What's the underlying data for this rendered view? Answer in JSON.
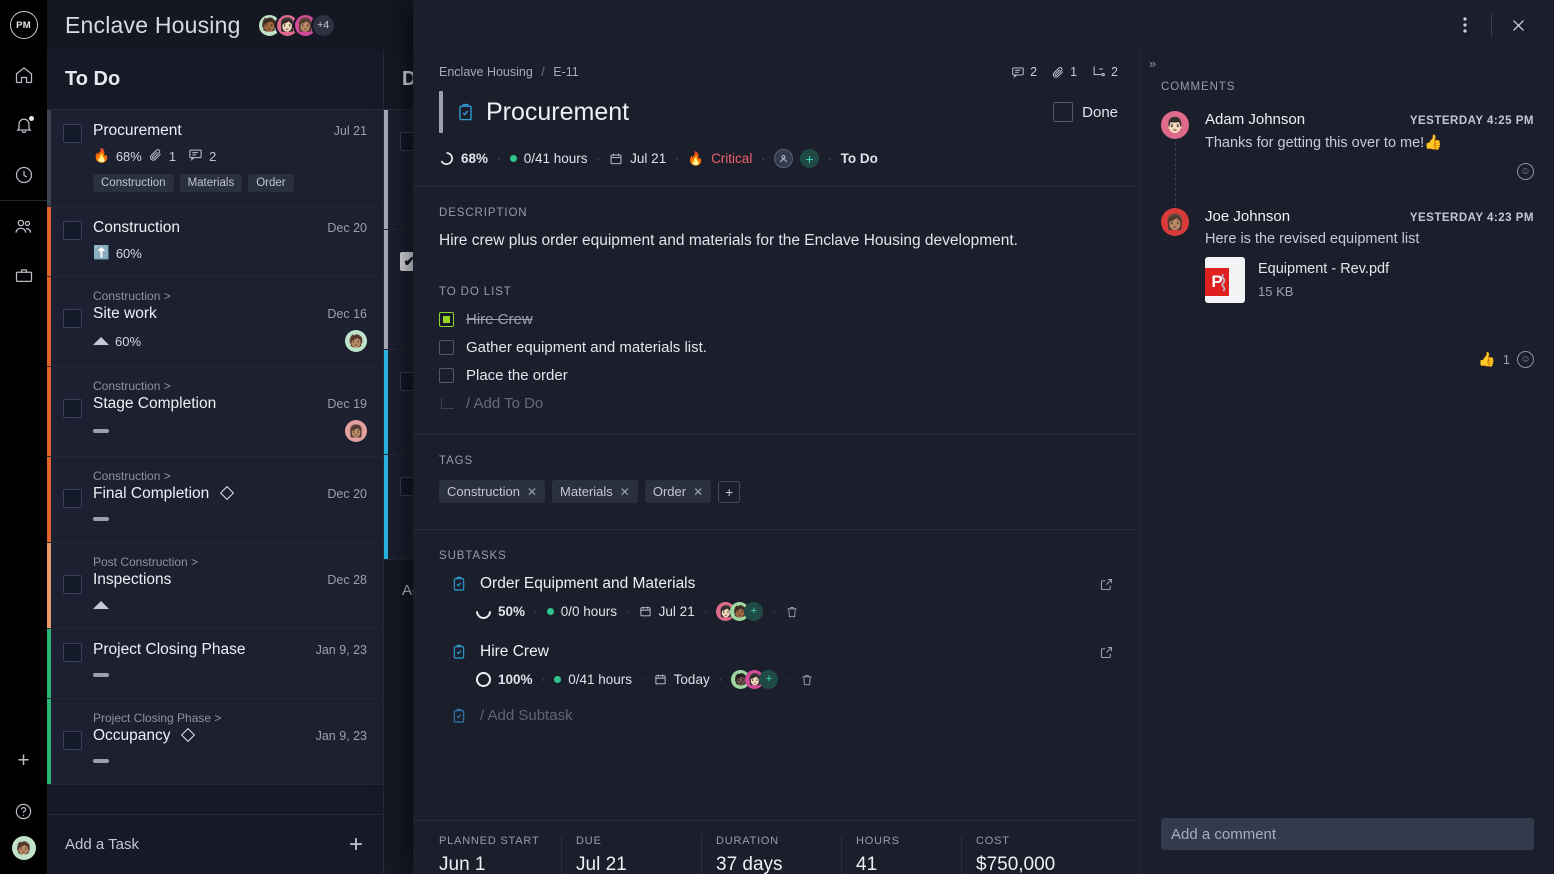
{
  "app": {
    "logo_text": "PM",
    "project_title": "Enclave Housing",
    "avatar_overflow": "+4"
  },
  "rail": {
    "items": [
      {
        "name": "home-icon"
      },
      {
        "name": "notifications-icon"
      },
      {
        "name": "time-icon"
      },
      {
        "name": "people-icon"
      },
      {
        "name": "portfolio-icon"
      }
    ],
    "add_label": "+",
    "help_label": "?"
  },
  "board": {
    "columns": [
      {
        "title": "To Do",
        "add_task_label": "Add a Task",
        "cards": [
          {
            "name": "Procurement",
            "date": "Jul 21",
            "parent": "",
            "percent": "68%",
            "priority_icon": "fire",
            "attachments": "1",
            "comments": "2",
            "tags": [
              "Construction",
              "Materials",
              "Order"
            ],
            "bar_color": "#3b4252",
            "avatar": ""
          },
          {
            "name": "Construction",
            "date": "Dec 20",
            "parent": "",
            "percent": "60%",
            "priority_icon": "up-arrow",
            "tags": [],
            "bar_color": "#e2622a",
            "avatar": ""
          },
          {
            "name": "Site work",
            "date": "Dec 16",
            "parent": "Construction >",
            "percent": "60%",
            "priority_icon": "triangle",
            "tags": [],
            "bar_color": "#e2622a",
            "avatar": "🧑🏽"
          },
          {
            "name": "Stage Completion",
            "date": "Dec 19",
            "parent": "Construction >",
            "percent": "",
            "priority_icon": "dash",
            "tags": [],
            "bar_color": "#e2622a",
            "avatar": "👩🏽"
          },
          {
            "name": "Final Completion",
            "date": "Dec 20",
            "parent": "Construction >",
            "percent": "",
            "priority_icon": "dash",
            "milestone": true,
            "tags": [],
            "bar_color": "#e2622a",
            "avatar": ""
          },
          {
            "name": "Inspections",
            "date": "Dec 28",
            "parent": "Post Construction >",
            "percent": "",
            "priority_icon": "triangle",
            "tags": [],
            "bar_color": "#e89a6b",
            "avatar": ""
          },
          {
            "name": "Project Closing Phase",
            "date": "Jan 9, 23",
            "parent": "",
            "percent": "",
            "priority_icon": "dash",
            "tags": [],
            "bar_color": "#2bb673",
            "avatar": ""
          },
          {
            "name": "Occupancy",
            "date": "Jan 9, 23",
            "parent": "Project Closing Phase >",
            "percent": "",
            "priority_icon": "dash",
            "milestone": true,
            "tags": [],
            "bar_color": "#2bb673",
            "avatar": ""
          }
        ]
      },
      {
        "title": "D",
        "add_task_label": "Ad",
        "cards": [
          {
            "bar_color": "#a9aeb8",
            "checked": false
          },
          {
            "bar_color": "#a9aeb8",
            "checked": true
          },
          {
            "bar_color": "#2ab8e6",
            "checked": false
          },
          {
            "bar_color": "#2ab8e6",
            "checked": false
          }
        ]
      }
    ]
  },
  "modal": {
    "menu_icon": "kebab-menu-icon",
    "close_icon": "close-icon",
    "breadcrumb": {
      "project": "Enclave Housing",
      "separator": "/",
      "id": "E-11"
    },
    "badges": {
      "comments": "2",
      "attachments": "1",
      "subtasks": "2"
    },
    "title": "Procurement",
    "done_label": "Done",
    "stats": {
      "percent": "68%",
      "hours": "0/41 hours",
      "due": "Jul 21",
      "priority": "Critical",
      "status": "To Do"
    },
    "description": {
      "label": "DESCRIPTION",
      "text": "Hire crew plus order equipment and materials for the Enclave Housing development."
    },
    "todo": {
      "label": "TO DO LIST",
      "items": [
        {
          "text": "Hire Crew",
          "done": true
        },
        {
          "text": "Gather equipment and materials list.",
          "done": false
        },
        {
          "text": "Place the order",
          "done": false
        }
      ],
      "add_placeholder": "/ Add To Do"
    },
    "tags": {
      "label": "TAGS",
      "items": [
        "Construction",
        "Materials",
        "Order"
      ],
      "add_label": "+"
    },
    "subtasks": {
      "label": "SUBTASKS",
      "items": [
        {
          "name": "Order Equipment and Materials",
          "percent": "50%",
          "hours": "0/0 hours",
          "due": "Jul 21",
          "avatars": [
            "👩🏻",
            "🧑🏾"
          ]
        },
        {
          "name": "Hire Crew",
          "percent": "100%",
          "hours": "0/41 hours",
          "due": "Today",
          "avatars": [
            "🧑🏿",
            "👩🏻"
          ]
        }
      ],
      "add_placeholder": "/ Add Subtask"
    },
    "bottom_stats": [
      {
        "key": "PLANNED START",
        "value": "Jun 1"
      },
      {
        "key": "DUE",
        "value": "Jul 21"
      },
      {
        "key": "DURATION",
        "value": "37 days"
      },
      {
        "key": "HOURS",
        "value": "41"
      },
      {
        "key": "COST",
        "value": "$750,000"
      }
    ]
  },
  "comments": {
    "collapse_icon": "chevron-double-right-icon",
    "label": "COMMENTS",
    "items": [
      {
        "author": "Adam Johnson",
        "time": "YESTERDAY 4:25 PM",
        "text": "Thanks for getting this over to me!👍",
        "avatar": "👨🏻",
        "avatar_bg": "#e06a8b",
        "reaction_count": "",
        "attachment": null
      },
      {
        "author": "Joe Johnson",
        "time": "YESTERDAY 4:23 PM",
        "text": "Here is the revised equipment list",
        "avatar": "👩🏽",
        "avatar_bg": "#d93a3a",
        "reaction_count": "1",
        "attachment": {
          "name": "Equipment - Rev.pdf",
          "size": "15 KB",
          "type": "P"
        }
      }
    ],
    "input_placeholder": "Add a comment"
  },
  "colors": {
    "accent_teal": "#3fd3c0",
    "critical_red": "#f0606b",
    "progress_green": "#31c48d",
    "todo_green": "#97d524",
    "column_orange": "#e2622a",
    "column_cyan": "#2ab8e6",
    "column_green": "#2bb673"
  }
}
